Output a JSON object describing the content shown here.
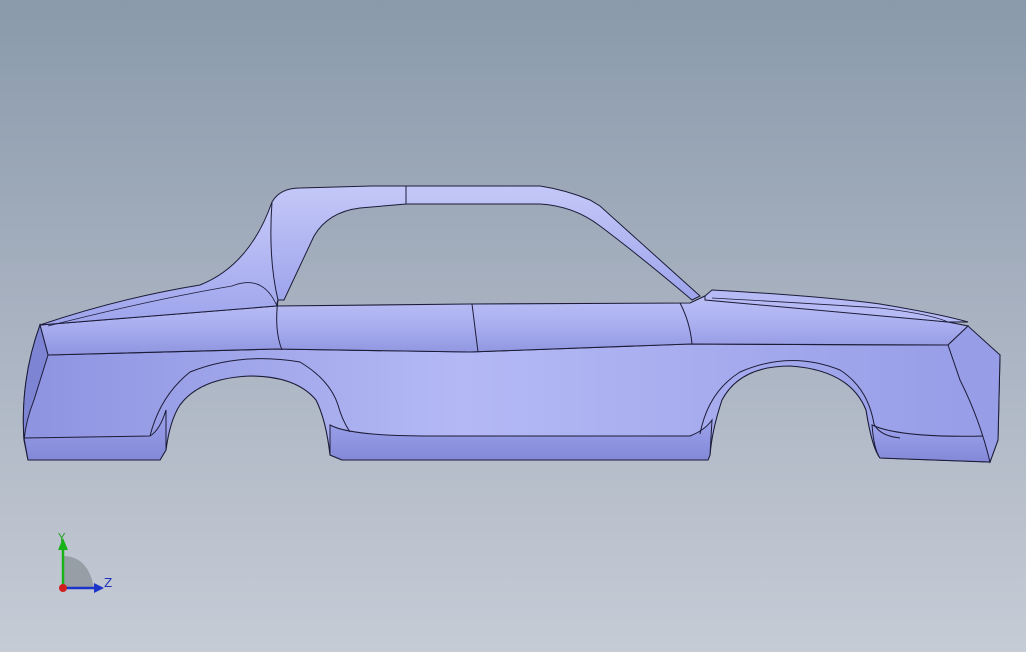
{
  "viewport": {
    "model": "car-body-side-view"
  },
  "triad": {
    "y_label": "Y",
    "z_label": "Z",
    "colors": {
      "y_axis": "#19b219",
      "z_axis": "#1c34c8",
      "x_axis": "#d21e1e",
      "label_y": "#2aa52a",
      "label_z": "#2233bb"
    }
  },
  "colors": {
    "background_top": "#8a9aab",
    "background_bottom": "#c6ccd6",
    "body_fill": "#a9aef0",
    "body_shadow": "#8d93e0",
    "edge": "#1c1c38"
  }
}
